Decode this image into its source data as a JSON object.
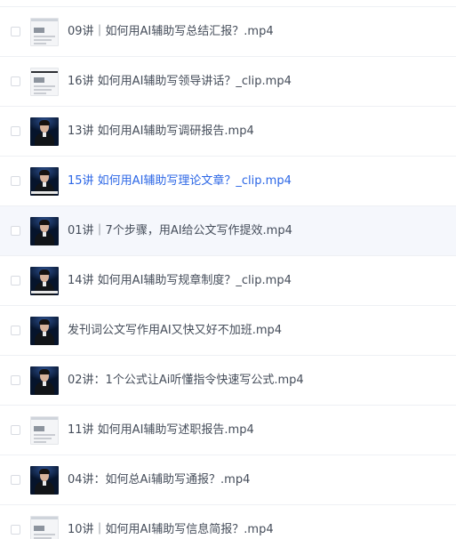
{
  "files": [
    {
      "name": "09讲｜如何用AI辅助写总结汇报？.mp4",
      "thumb": "doc",
      "state": "normal"
    },
    {
      "name": "16讲 如何用AI辅助写领导讲话？_clip.mp4",
      "thumb": "doc-dark",
      "state": "normal"
    },
    {
      "name": "13讲 如何用AI辅助写调研报告.mp4",
      "thumb": "video",
      "state": "normal"
    },
    {
      "name": "15讲 如何用AI辅助写理论文章？_clip.mp4",
      "thumb": "video-caption",
      "state": "active"
    },
    {
      "name": "01讲｜7个步骤，用AI给公文写作提效.mp4",
      "thumb": "video",
      "state": "hovered"
    },
    {
      "name": "14讲 如何用AI辅助写规章制度？_clip.mp4",
      "thumb": "video-caption",
      "state": "normal"
    },
    {
      "name": "发刊词公文写作用AI又快又好不加班.mp4",
      "thumb": "video",
      "state": "normal"
    },
    {
      "name": "02讲：1个公式让Ai听懂指令快速写公式.mp4",
      "thumb": "video",
      "state": "normal"
    },
    {
      "name": "11讲 如何用AI辅助写述职报告.mp4",
      "thumb": "doc",
      "state": "normal"
    },
    {
      "name": "04讲：如何总Ai辅助写通报？.mp4",
      "thumb": "video",
      "state": "normal"
    },
    {
      "name": "10讲｜如何用AI辅助写信息简报？.mp4",
      "thumb": "doc",
      "state": "normal"
    }
  ]
}
